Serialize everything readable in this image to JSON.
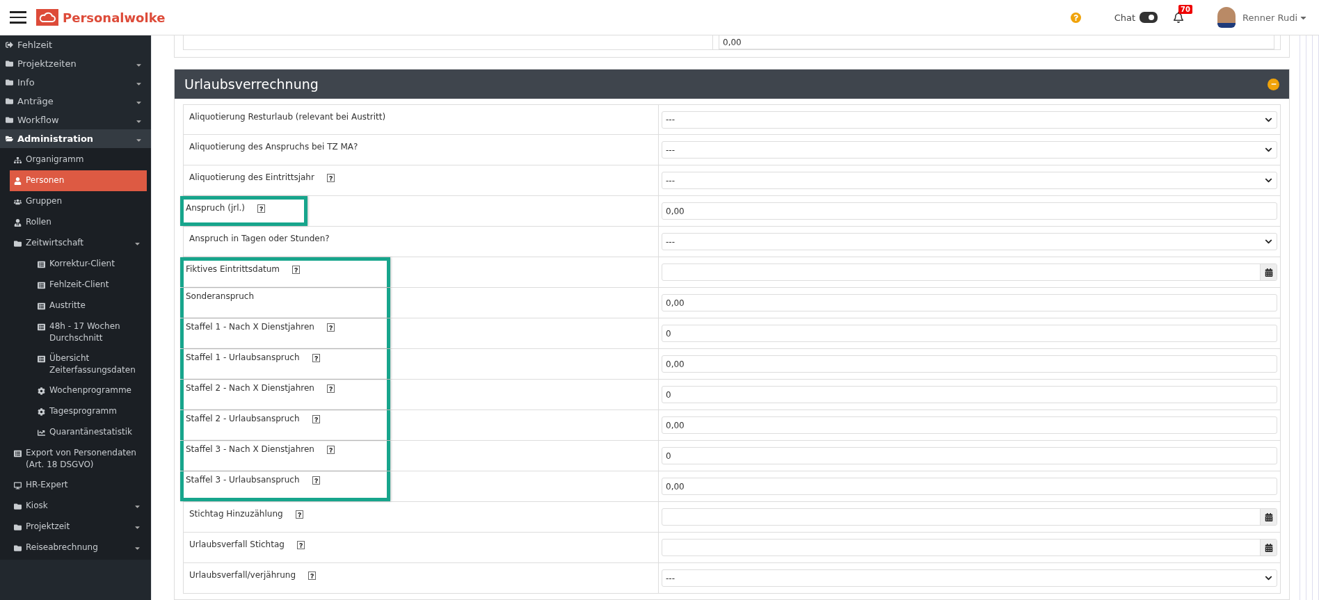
{
  "header": {
    "brand": "Personalwolke",
    "chat_label": "Chat",
    "chat_on": true,
    "notification_count": "70",
    "user_name": "Renner Rudi"
  },
  "sidebar": {
    "items": [
      {
        "label": "Fehlzeit",
        "kind": "link",
        "expanded": false
      },
      {
        "label": "Projektzeiten",
        "kind": "folder",
        "expanded": false
      },
      {
        "label": "Info",
        "kind": "folder",
        "expanded": false
      },
      {
        "label": "Anträge",
        "kind": "folder",
        "expanded": false
      },
      {
        "label": "Workflow",
        "kind": "folder",
        "expanded": false
      },
      {
        "label": "Administration",
        "kind": "folder",
        "expanded": true,
        "children": [
          {
            "label": "Organigramm",
            "kind": "org",
            "selected": false
          },
          {
            "label": "Personen",
            "kind": "user",
            "selected": true
          },
          {
            "label": "Gruppen",
            "kind": "users",
            "selected": false
          },
          {
            "label": "Rollen",
            "kind": "role",
            "selected": false
          },
          {
            "label": "Zeitwirtschaft",
            "kind": "folder",
            "expanded": true,
            "selected": false,
            "children": [
              {
                "label": "Korrektur-Client",
                "kind": "list",
                "selected": false
              },
              {
                "label": "Fehlzeit-Client",
                "kind": "list",
                "selected": false
              },
              {
                "label": "Austritte",
                "kind": "list",
                "selected": false
              },
              {
                "label": "48h - 17 Wochen Durchschnitt",
                "kind": "list",
                "selected": false
              },
              {
                "label": "Übersicht Zeiterfassungsdaten",
                "kind": "list",
                "selected": false
              },
              {
                "label": "Wochenprogramme",
                "kind": "gear",
                "selected": false
              },
              {
                "label": "Tagesprogramm",
                "kind": "gear",
                "selected": false
              },
              {
                "label": "Quarantänestatistik",
                "kind": "chart",
                "selected": false
              }
            ]
          },
          {
            "label": "Export von Personendaten (Art. 18 DSGVO)",
            "kind": "list",
            "selected": false
          },
          {
            "label": "HR-Expert",
            "kind": "monitor",
            "selected": false
          },
          {
            "label": "Kiosk",
            "kind": "folder",
            "expanded": false,
            "selected": false
          },
          {
            "label": "Projektzeit",
            "kind": "folder",
            "expanded": false,
            "selected": false
          },
          {
            "label": "Reiseabrechnung",
            "kind": "folder",
            "expanded": false,
            "selected": false
          }
        ]
      }
    ]
  },
  "previous_section": {
    "value": "0,00"
  },
  "panel": {
    "title": "Urlaubsverrechnung",
    "collapsed": false,
    "rows": [
      {
        "label": "Aliquotierung Resturlaub (relevant bei Austritt)",
        "kind": "select",
        "value": "---",
        "help": false,
        "highlighted": false
      },
      {
        "label": "Aliquotierung des Anspruchs bei TZ MA?",
        "kind": "select",
        "value": "---",
        "help": false,
        "highlighted": false
      },
      {
        "label": "Aliquotierung des Eintrittsjahr",
        "kind": "select",
        "value": "---",
        "help": true,
        "highlighted": false
      },
      {
        "label": "Anspruch (jrl.)",
        "kind": "text",
        "value": "0,00",
        "help": true,
        "highlighted": true
      },
      {
        "label": "Anspruch in Tagen oder Stunden?",
        "kind": "select",
        "value": "---",
        "help": false,
        "highlighted": false
      },
      {
        "label": "Fiktives Eintrittsdatum",
        "kind": "date",
        "help": true,
        "highlighted": true
      },
      {
        "label": "Sonderanspruch",
        "kind": "text",
        "value": "0,00",
        "help": false,
        "highlighted": true
      },
      {
        "label": "Staffel 1 - Nach X Dienstjahren",
        "kind": "text",
        "value": "0",
        "help": true,
        "highlighted": true
      },
      {
        "label": "Staffel 1 - Urlaubsanspruch",
        "kind": "text",
        "value": "0,00",
        "help": true,
        "highlighted": true
      },
      {
        "label": "Staffel 2 - Nach X Dienstjahren",
        "kind": "text",
        "value": "0",
        "help": true,
        "highlighted": true
      },
      {
        "label": "Staffel 2 - Urlaubsanspruch",
        "kind": "text",
        "value": "0,00",
        "help": true,
        "highlighted": true
      },
      {
        "label": "Staffel 3 - Nach X Dienstjahren",
        "kind": "text",
        "value": "0",
        "help": true,
        "highlighted": true
      },
      {
        "label": "Staffel 3 - Urlaubsanspruch",
        "kind": "text",
        "value": "0,00",
        "help": true,
        "highlighted": true
      },
      {
        "label": "Stichtag Hinzuzählung",
        "kind": "date",
        "help": true,
        "highlighted": false
      },
      {
        "label": "Urlaubsverfall Stichtag",
        "kind": "date",
        "help": true,
        "highlighted": false
      },
      {
        "label": "Urlaubsverfall/verjährung",
        "kind": "select",
        "value": "---",
        "help": true,
        "highlighted": false
      }
    ]
  }
}
